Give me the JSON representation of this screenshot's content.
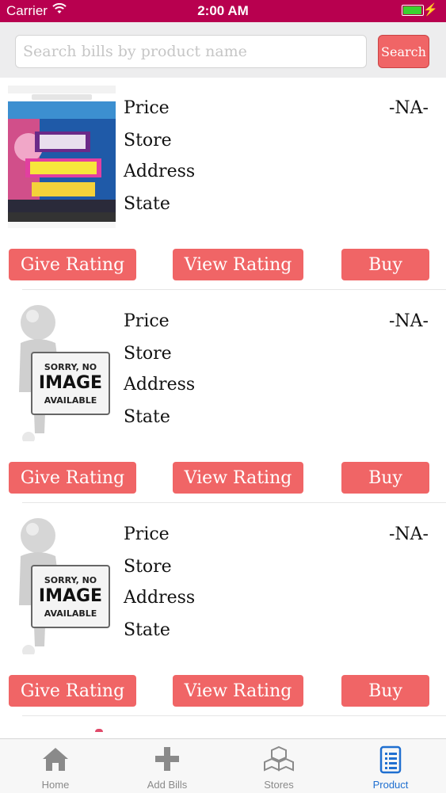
{
  "status_bar": {
    "carrier": "Carrier",
    "time": "2:00 AM"
  },
  "search": {
    "placeholder": "Search bills by product name",
    "button_label": "Search"
  },
  "products": [
    {
      "fields": [
        "Price",
        "Store",
        "Address",
        "State"
      ],
      "price_value": "-NA-",
      "image": "app-screenshot-thumbnail",
      "buttons": {
        "give": "Give Rating",
        "view": "View Rating",
        "buy": "Buy"
      }
    },
    {
      "fields": [
        "Price",
        "Store",
        "Address",
        "State"
      ],
      "price_value": "-NA-",
      "image": "no-image-placeholder",
      "placeholder_text": [
        "SORRY, NO",
        "IMAGE",
        "AVAILABLE"
      ],
      "buttons": {
        "give": "Give Rating",
        "view": "View Rating",
        "buy": "Buy"
      }
    },
    {
      "fields": [
        "Price",
        "Store",
        "Address",
        "State"
      ],
      "price_value": "-NA-",
      "image": "no-image-placeholder",
      "placeholder_text": [
        "SORRY, NO",
        "IMAGE",
        "AVAILABLE"
      ],
      "buttons": {
        "give": "Give Rating",
        "view": "View Rating",
        "buy": "Buy"
      }
    }
  ],
  "tab_bar": {
    "tabs": [
      {
        "label": "Home",
        "icon": "home-icon"
      },
      {
        "label": "Add Bills",
        "icon": "plus-icon"
      },
      {
        "label": "Stores",
        "icon": "boxes-icon"
      },
      {
        "label": "Product",
        "icon": "list-document-icon",
        "active": true
      }
    ]
  },
  "colors": {
    "status_bar": "#b8004f",
    "accent": "#f06566",
    "active_tab": "#1f6fd0"
  }
}
